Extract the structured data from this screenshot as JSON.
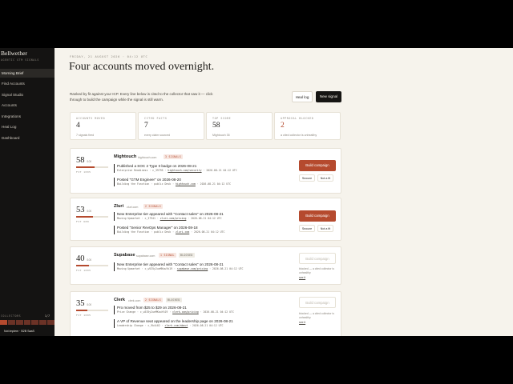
{
  "sidebar": {
    "brand": "Bellwether",
    "subtitle": "AGENTIC GTM SIGNALS",
    "items": [
      {
        "label": "Morning Brief",
        "active": true
      },
      {
        "label": "Find Accounts"
      },
      {
        "label": "Signal Studio"
      },
      {
        "label": "Accounts"
      },
      {
        "label": "Integrations"
      },
      {
        "label": "Heal Log"
      },
      {
        "label": "Dashboard"
      }
    ],
    "footer_label": "COLLECTORS",
    "footer_count": "1/7",
    "toast": "Not implem · B2B SaaS"
  },
  "header": {
    "dateline": "FRIDAY, 21 AUGUST 2026 · 04:12 UTC",
    "title": "Four accounts moved overnight.",
    "intro": "Ranked by fit against your ICP. Every line below is cited to the collector that saw it — click through to build the campaign while the signal is still warm.",
    "heal_log_label": "Heal log",
    "new_signal_label": "New signal"
  },
  "stats": [
    {
      "label": "ACCOUNTS MOVED",
      "value": "4",
      "note": "7 signals fired"
    },
    {
      "label": "CITED FACTS",
      "value": "7",
      "note": "every claim sourced"
    },
    {
      "label": "TOP SCORE",
      "value": "58",
      "note": "Mightouch 35"
    },
    {
      "label": "APPROVAL BLOCKED",
      "value": "2",
      "note": "a cited collector is unhealthy",
      "accent": true
    }
  ],
  "cards": [
    {
      "score": "58",
      "score_sub": "/100",
      "fit": 0.58,
      "score_label": "FIT 1005",
      "company": "Mightouch",
      "domain": "hightouch.com",
      "tags": [
        {
          "text": "3 SIGNALS",
          "kind": "sig"
        }
      ],
      "signals": [
        {
          "title": "Published a SOC 2 Type II badge on 2026-08-21",
          "meta_a": "Enterprise Readiness · c_39795 · ",
          "link": "hightouch.com/security",
          "meta_b": " · 2026-08-21 04:12 UTC"
        },
        {
          "title": "Posted \"GTM Engineer\" on 2026-08-20",
          "meta_a": "Building the Function · public Desk · ",
          "link": "hightouch.com",
          "meta_b": " · 2026-08-21 04:12 UTC"
        }
      ],
      "primary": "Build campaign",
      "snooze": "Snooze",
      "notfit": "Not a fit",
      "blocked": false
    },
    {
      "score": "53",
      "score_sub": "/100",
      "fit": 0.53,
      "score_label": "FIT 688",
      "company": "Zluri",
      "domain": "zluri.com",
      "tags": [
        {
          "text": "2 SIGNALS",
          "kind": "sig"
        }
      ],
      "signals": [
        {
          "title": "New Enterprise tier appeared with \"Contact sales\" on 2026-08-21",
          "meta_a": "Moving Upmarket · c_37941 · ",
          "link": "zluri.com/pricing",
          "meta_b": " · 2026-08-21 04:12 UTC"
        },
        {
          "title": "Posted \"Senior RevOps Manager\" on 2026-08-18",
          "meta_a": "Building the Function · public Desk · ",
          "link": "zluri.com",
          "meta_b": " · 2026-08-21 04:12 UTC"
        }
      ],
      "primary": "Build campaign",
      "snooze": "Snooze",
      "notfit": "Not a fit",
      "blocked": false
    },
    {
      "score": "40",
      "score_sub": "/100",
      "fit": 0.4,
      "score_label": "FIT 1005",
      "company": "Supabase",
      "domain": "supabase.com",
      "tags": [
        {
          "text": "1 SIGNAL",
          "kind": "sig"
        },
        {
          "text": "BLOCKED",
          "kind": "blocked"
        }
      ],
      "signals": [
        {
          "title": "New Enterprise tier appeared with \"Contact sales\" on 2026-08-21",
          "meta_a": "Moving Upmarket · c_w535y2ueMKauYk19 · ",
          "link": "supabase.com/pricing",
          "meta_b": " · 2026-08-21 04:12 UTC"
        }
      ],
      "primary": "Build campaign",
      "blocked": true,
      "blocked_note": "blocked — a cited collector is unhealthy",
      "blocked_link": "see it"
    },
    {
      "score": "35",
      "score_sub": "/100",
      "fit": 0.35,
      "score_label": "FIT 1005",
      "company": "Clerk",
      "domain": "clerk.com",
      "tags": [
        {
          "text": "2 SIGNALS",
          "kind": "sig"
        },
        {
          "text": "BLOCKED",
          "kind": "blocked"
        }
      ],
      "signals": [
        {
          "title": "Pro moved from $25 to $29 on 2026-08-21",
          "meta_a": "Price Change · c_w535y2ueMKauYk19 · ",
          "link": "clerk.com/pricing",
          "meta_b": " · 2026-08-21 04:12 UTC"
        },
        {
          "title": "A VP of Revenue seat appeared on the leadership page on 2026-08-21",
          "meta_a": "Leadership Change · c_9k4i02 · ",
          "link": "clerk.com/about",
          "meta_b": " · 2026-08-21 04:12 UTC"
        }
      ],
      "primary": "Build campaign",
      "blocked": true,
      "blocked_note": "blocked — a cited collector is unhealthy",
      "blocked_link": "see it"
    }
  ]
}
